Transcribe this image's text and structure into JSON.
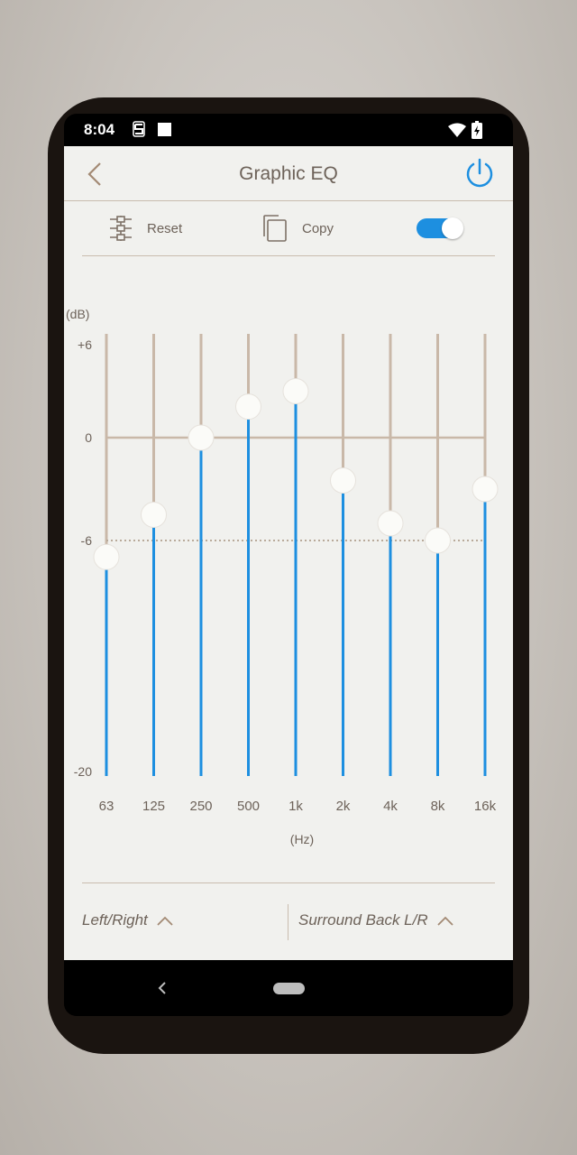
{
  "status_bar": {
    "time": "8:04"
  },
  "header": {
    "title": "Graphic EQ"
  },
  "toolbar": {
    "reset_label": "Reset",
    "copy_label": "Copy",
    "toggle_on": true
  },
  "chart_data": {
    "type": "bar",
    "title": "",
    "ylabel": "(dB)",
    "xlabel": "(Hz)",
    "ylim": [
      -20,
      6
    ],
    "yticks": [
      "+6",
      "0",
      "-6",
      "-20"
    ],
    "ytick_values": [
      6,
      0,
      -6,
      -20
    ],
    "reference_line": -6,
    "categories": [
      "63",
      "125",
      "250",
      "500",
      "1k",
      "2k",
      "4k",
      "8k",
      "16k"
    ],
    "values": [
      -7,
      -4.5,
      0,
      2,
      3,
      -2.5,
      -5,
      -6,
      -3
    ]
  },
  "bottom": {
    "left_selector": "Left/Right",
    "right_selector": "Surround Back L/R"
  },
  "colors": {
    "accent": "#1d8fe0",
    "track": "#c9b8a8",
    "text": "#6d6259",
    "background": "#f1f1ee"
  }
}
